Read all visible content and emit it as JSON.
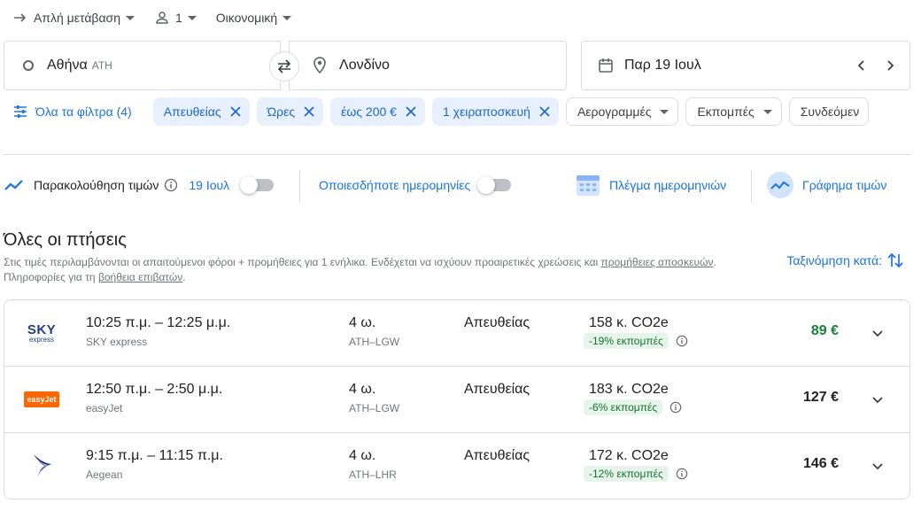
{
  "trip_options": {
    "trip_type": "Απλή μετάβαση",
    "passengers": "1",
    "cabin_class": "Οικονομική"
  },
  "search": {
    "origin": "Αθήνα",
    "origin_code": "ATH",
    "destination": "Λονδίνο",
    "date": "Παρ 19 Ιουλ"
  },
  "filters": {
    "all_filters_label": "Όλα τα φίλτρα (4)",
    "active_chips": [
      {
        "label": "Απευθείας"
      },
      {
        "label": "Ώρες"
      },
      {
        "label": "έως 200 €"
      },
      {
        "label": "1 χειραποσκευή"
      }
    ],
    "dropdown_chips": [
      {
        "label": "Αερογραμμές"
      },
      {
        "label": "Εκπομπές"
      },
      {
        "label": "Συνδεόμεν"
      }
    ]
  },
  "tools": {
    "track_prices_label": "Παρακολούθηση τιμών",
    "track_date": "19 Ιουλ",
    "any_dates_label": "Οποιεσδήποτε ημερομηνίες",
    "date_grid_label": "Πλέγμα ημερομηνιών",
    "price_graph_label": "Γράφημα τιμών"
  },
  "results": {
    "heading": "Όλες οι πτήσεις",
    "note_prefix": "Στις τιμές περιλαμβάνονται οι απαιτούμενοι φόροι + προμήθειες για 1 ενήλικα. Ενδέχεται να ισχύουν προαιρετικές χρεώσεις και ",
    "note_link1": "προμήθειες αποσκευών",
    "note_middle": ". Πληροφορίες για τη ",
    "note_link2": "βοήθεια επιβατών",
    "note_suffix": ".",
    "sort_label": "Ταξινόμηση κατά:"
  },
  "flights": [
    {
      "logo_text": "SKY",
      "logo_sub": "express",
      "times": "10:25 π.μ. – 12:25 μ.μ.",
      "airline": "SKY express",
      "duration": "4 ω.",
      "route": "ATH–LGW",
      "stops": "Απευθείας",
      "co2": "158 κ. CO2e",
      "emissions": "-19% εκπομπές",
      "price": "89 €"
    },
    {
      "logo_text": "easyJet",
      "times": "12:50 π.μ. – 2:50 μ.μ.",
      "airline": "easyJet",
      "duration": "4 ω.",
      "route": "ATH–LGW",
      "stops": "Απευθείας",
      "co2": "183 κ. CO2e",
      "emissions": "-6% εκπομπές",
      "price": "127 €"
    },
    {
      "times": "9:15 π.μ. – 11:15 π.μ.",
      "airline": "Aegean",
      "duration": "4 ω.",
      "route": "ATH–LHR",
      "stops": "Απευθείας",
      "co2": "172 κ. CO2e",
      "emissions": "-12% εκπομπές",
      "price": "146 €"
    }
  ],
  "colors": {
    "accent": "#1a73e8",
    "chip_bg": "#e8f0fe",
    "cheapest_price": "#188038",
    "emissions_badge_bg": "#e6f4ea",
    "emissions_badge_text": "#137333",
    "easyjet_orange": "#ff6600",
    "sky_navy": "#1f3f7f",
    "aegean_navy": "#1a2e6e"
  }
}
